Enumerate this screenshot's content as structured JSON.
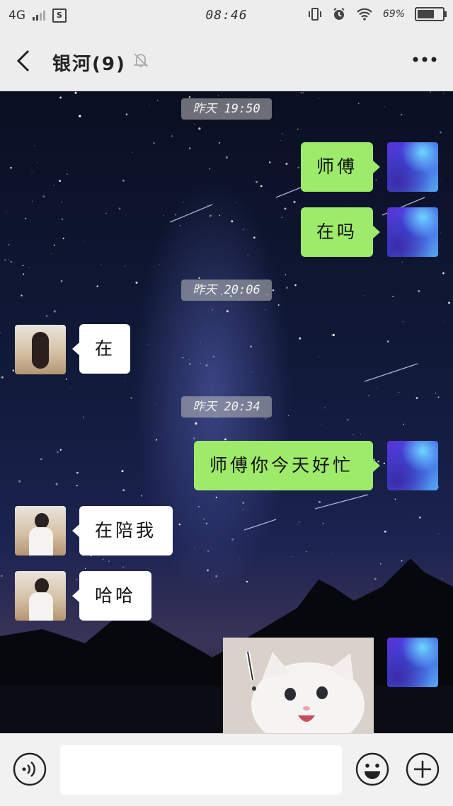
{
  "status_bar": {
    "network": "4G",
    "app_badge": "S",
    "time": "08:46",
    "battery_text": "69%",
    "battery_level": 0.69
  },
  "header": {
    "title": "银河(9)",
    "icons": [
      "back-arrow-icon",
      "mute-bell-icon",
      "more-dots-icon"
    ]
  },
  "messages": [
    {
      "type": "time",
      "text": "昨天 19:50"
    },
    {
      "type": "text",
      "from": "me",
      "text": "师傅"
    },
    {
      "type": "text",
      "from": "me",
      "text": "在吗"
    },
    {
      "type": "time",
      "text": "昨天 20:06"
    },
    {
      "type": "text",
      "from": "other",
      "text": "在"
    },
    {
      "type": "time",
      "text": "昨天 20:34"
    },
    {
      "type": "text",
      "from": "me",
      "text": "师傅你今天好忙"
    },
    {
      "type": "text",
      "from": "other",
      "text": "在陪我"
    },
    {
      "type": "text",
      "from": "other",
      "text": "哈哈"
    },
    {
      "type": "image",
      "from": "me",
      "text": ""
    }
  ],
  "input_bar": {
    "placeholder": "",
    "value": "",
    "icons": [
      "voice-icon",
      "emoji-icon",
      "plus-icon"
    ]
  },
  "colors": {
    "outgoing_bubble": "#9eea6a",
    "incoming_bubble": "#ffffff",
    "bar_background": "#ededed"
  }
}
